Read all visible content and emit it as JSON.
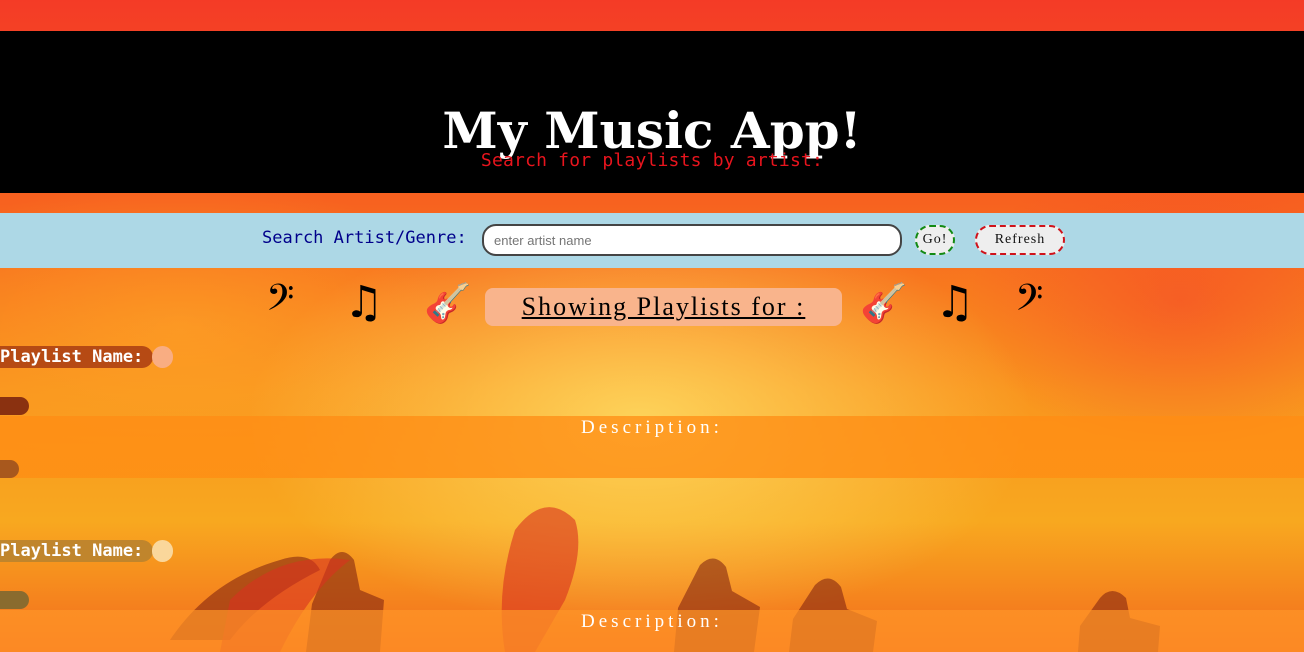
{
  "header": {
    "title": "My Music App!",
    "subtitle": "Search for playlists by artist:"
  },
  "search": {
    "label": "Search Artist/Genre:",
    "placeholder": "enter artist name",
    "value": "",
    "go_label": "Go!",
    "refresh_label": "Refresh"
  },
  "showing": {
    "label": "Showing Playlists for :",
    "icons_left": [
      "bass-clef-icon",
      "music-note-icon",
      "guitar-icon"
    ],
    "icons_right": [
      "guitar-icon",
      "music-note-icon",
      "bass-clef-icon"
    ],
    "glyphs": {
      "bass_clef": "𝄢",
      "music_note": "♫",
      "guitar": "🎸"
    }
  },
  "playlists": [
    {
      "name_label": "Playlist Name:",
      "description_label": "Description:"
    },
    {
      "name_label": "Playlist Name:",
      "description_label": "Description:"
    }
  ],
  "colors": {
    "header_bg": "#000000",
    "header_title": "#ffffff",
    "header_subtitle": "#e8141d",
    "search_bar_bg": "#add8e6",
    "search_label": "#00008b",
    "go_border": "#138a13",
    "refresh_border": "#d0121a",
    "showing_badge_bg": "#f9b48c"
  }
}
